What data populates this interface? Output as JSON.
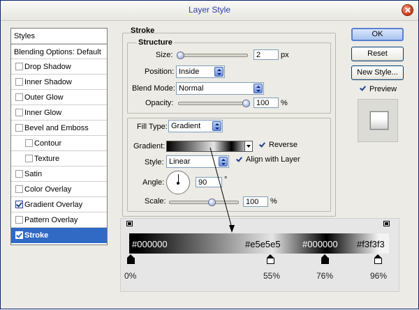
{
  "window": {
    "title": "Layer Style"
  },
  "styles_list": {
    "header": "Styles",
    "blending": "Blending Options: Default",
    "items": [
      {
        "label": "Drop Shadow",
        "checked": false
      },
      {
        "label": "Inner Shadow",
        "checked": false
      },
      {
        "label": "Outer Glow",
        "checked": false
      },
      {
        "label": "Inner Glow",
        "checked": false
      },
      {
        "label": "Bevel and Emboss",
        "checked": false
      },
      {
        "label": "Contour",
        "checked": false,
        "indent": true
      },
      {
        "label": "Texture",
        "checked": false,
        "indent": true
      },
      {
        "label": "Satin",
        "checked": false
      },
      {
        "label": "Color Overlay",
        "checked": false
      },
      {
        "label": "Gradient Overlay",
        "checked": true
      },
      {
        "label": "Pattern Overlay",
        "checked": false
      },
      {
        "label": "Stroke",
        "checked": true,
        "selected": true
      }
    ]
  },
  "stroke": {
    "title": "Stroke",
    "structure_title": "Structure",
    "size_label": "Size:",
    "size_value": "2",
    "size_unit": "px",
    "position_label": "Position:",
    "position_value": "Inside",
    "blend_label": "Blend Mode:",
    "blend_value": "Normal",
    "opacity_label": "Opacity:",
    "opacity_value": "100",
    "opacity_unit": "%",
    "filltype_label": "Fill Type:",
    "filltype_value": "Gradient",
    "gradient_label": "Gradient:",
    "reverse_label": "Reverse",
    "reverse_checked": true,
    "style_label": "Style:",
    "style_value": "Linear",
    "align_label": "Align with Layer",
    "align_checked": true,
    "angle_label": "Angle:",
    "angle_value": "90",
    "angle_unit": "°",
    "scale_label": "Scale:",
    "scale_value": "100",
    "scale_unit": "%"
  },
  "buttons": {
    "ok": "OK",
    "reset": "Reset",
    "new_style": "New Style...",
    "preview": "Preview",
    "preview_checked": true
  },
  "gradient_editor": {
    "stops": [
      {
        "color": "#000000",
        "location": "0%"
      },
      {
        "color": "#e5e5e5",
        "location": "55%"
      },
      {
        "color": "#000000",
        "location": "76%"
      },
      {
        "color": "#f3f3f3",
        "location": "96%"
      }
    ]
  }
}
